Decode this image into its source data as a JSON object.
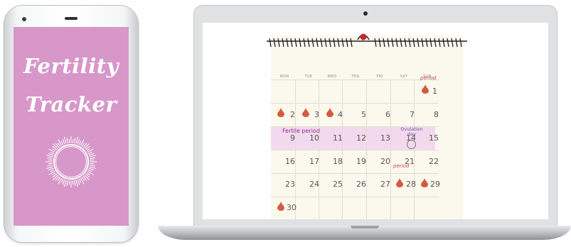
{
  "phone": {
    "title_line1": "Fertility",
    "title_line2": "Tracker",
    "icon": "sun-circle-logo-icon"
  },
  "calendar": {
    "weekdays": [
      "MON",
      "TUE",
      "WED",
      "THU",
      "FRI",
      "SAT",
      "SUN"
    ],
    "fertile_label": "Fertile period",
    "ovulation_label_line1": "Ovulation",
    "ovulation_label_line2": "day",
    "period_label": "period",
    "days": {
      "d1": "1",
      "d2": "2",
      "d3": "3",
      "d4": "4",
      "d5": "5",
      "d6": "6",
      "d7": "7",
      "d8": "8",
      "d9": "9",
      "d10": "10",
      "d11": "11",
      "d12": "12",
      "d13": "13",
      "d14": "14",
      "d15": "15",
      "d16": "16",
      "d17": "17",
      "d18": "18",
      "d19": "19",
      "d20": "20",
      "d21": "21",
      "d22": "22",
      "d23": "23",
      "d24": "24",
      "d25": "25",
      "d26": "26",
      "d27": "27",
      "d28": "28",
      "d29": "29",
      "d30": "30"
    },
    "colors": {
      "drop": "#d55a40",
      "fertile_band": "#f3d9ee",
      "period_text": "#c7445a",
      "ovulation_text": "#6f4aa5",
      "fertile_text": "#8c2f86"
    }
  }
}
